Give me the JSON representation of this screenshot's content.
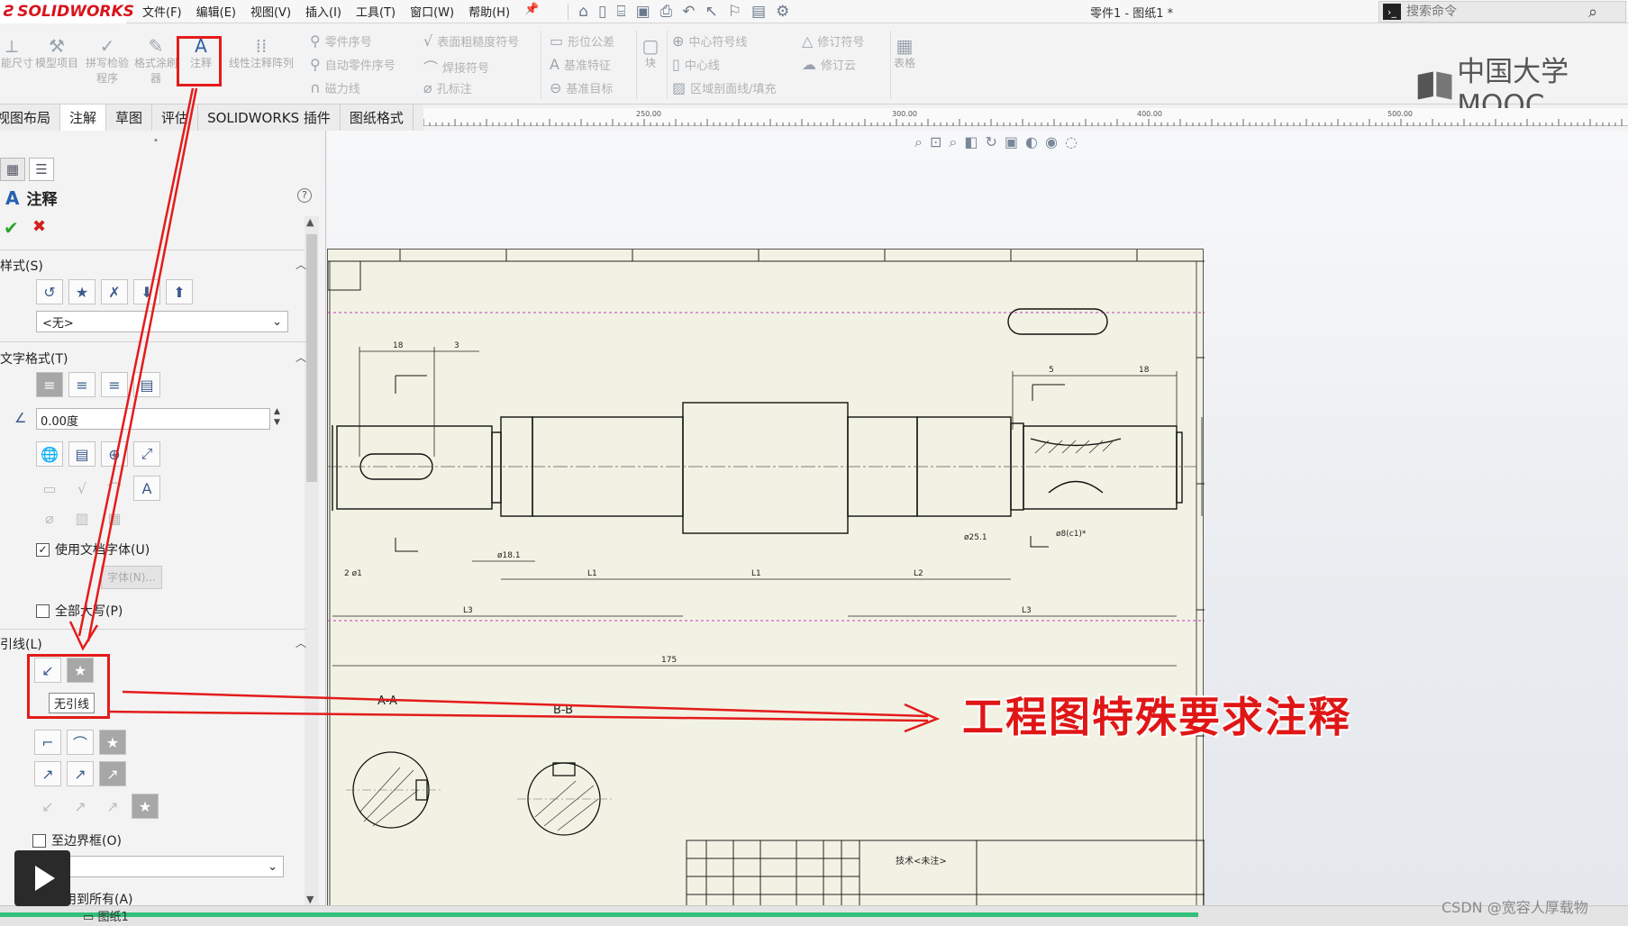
{
  "app": {
    "brand": "SOLIDWORKS",
    "document_title": "零件1 - 图纸1 *"
  },
  "menu": [
    "文件(F)",
    "编辑(E)",
    "视图(V)",
    "插入(I)",
    "工具(T)",
    "窗口(W)",
    "帮助(H)"
  ],
  "search": {
    "placeholder": "搜索命令"
  },
  "ribbon": {
    "big_buttons": [
      {
        "label": "智能尺寸",
        "icon": "smart-dimension-icon"
      },
      {
        "label": "模型项目",
        "icon": "model-items-icon"
      },
      {
        "label": "拼写检验程序",
        "icon": "spell-check-icon"
      },
      {
        "label": "格式涂刷器",
        "icon": "format-painter-icon"
      },
      {
        "label": "注释",
        "icon": "note-icon"
      },
      {
        "label": "线性注释阵列",
        "icon": "linear-note-pattern-icon"
      }
    ],
    "small_col1": [
      "零件序号",
      "自动零件序号",
      "磁力线"
    ],
    "small_col2": [
      "表面粗糙度符号",
      "焊接符号",
      "孔标注"
    ],
    "small_col3": [
      "形位公差",
      "基准特征",
      "基准目标"
    ],
    "block_label": "块",
    "small_col4": [
      "中心符号线",
      "中心线",
      "区域剖面线/填充"
    ],
    "small_col5": [
      "修订符号",
      "修订云"
    ],
    "table_label": "表格"
  },
  "watermark_logo": "中国大学MOOC",
  "tabs": [
    {
      "label": "视图布局",
      "active": false
    },
    {
      "label": "注解",
      "active": true
    },
    {
      "label": "草图",
      "active": false
    },
    {
      "label": "评估",
      "active": false
    },
    {
      "label": "SOLIDWORKS 插件",
      "active": false
    },
    {
      "label": "图纸格式",
      "active": false
    }
  ],
  "ruler_ticks": [
    "250.00",
    "300.00",
    "400.00",
    "500.00"
  ],
  "property_manager": {
    "title": "注释",
    "style_section": "样式(S)",
    "style_value": "<无>",
    "text_format_section": "文字格式(T)",
    "angle_value": "0.00度",
    "use_doc_font": "使用文档字体(U)",
    "use_doc_font_checked": true,
    "font_button": "字体(N)...",
    "all_caps": "全部大写(P)",
    "all_caps_checked": false,
    "leader_section": "引线(L)",
    "tooltip": "无引线",
    "to_boundary": "至边界框(O)",
    "apply_all": "应用到所有(A)"
  },
  "drawing": {
    "section_a": "A-A",
    "section_b": "B-B",
    "title_block_text": "技术<未注>",
    "overall_length": "175"
  },
  "annotation_callout": "工程图特殊要求注释",
  "sheet_tab": "图纸1",
  "watermark": "CSDN @宽容人厚载物",
  "colors": {
    "highlight_red": "#e41b1b",
    "sheet_bg": "#f2f2e4",
    "brand_red": "#d8141c",
    "progress_green": "#31bf7a"
  }
}
